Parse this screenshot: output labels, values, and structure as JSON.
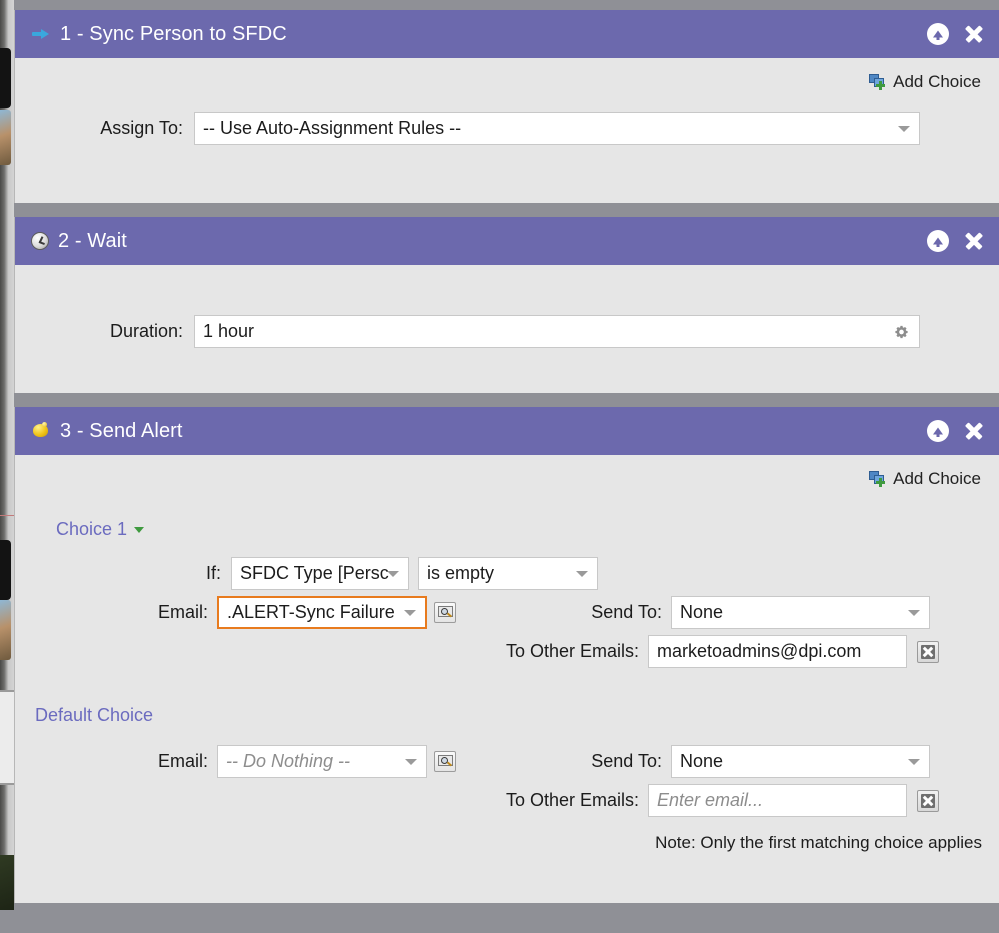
{
  "steps": [
    {
      "icon": "arrow-right-icon",
      "title": "1 - Sync Person to SFDC",
      "collapse_label": "Collapse step",
      "close_label": "Remove step",
      "add_choice_label": "Add Choice",
      "assign_to_label": "Assign To:",
      "assign_to_value": "-- Use Auto-Assignment Rules --"
    },
    {
      "icon": "clock-icon",
      "title": "2 - Wait",
      "duration_label": "Duration:",
      "duration_value": "1 hour"
    },
    {
      "icon": "bell-icon",
      "title": "3 - Send Alert",
      "add_choice_label": "Add Choice",
      "choice_1": {
        "label": "Choice 1",
        "if_label": "If:",
        "if_field_value": "SFDC Type [Persc",
        "if_operator_value": "is empty",
        "email_label": "Email:",
        "email_value": ".ALERT-Sync Failure",
        "send_to_label": "Send To:",
        "send_to_value": "None",
        "to_other_emails_label": "To Other Emails:",
        "to_other_emails_value": "marketoadmins@dpi.com"
      },
      "default_choice": {
        "label": "Default Choice",
        "email_label": "Email:",
        "email_value": "-- Do Nothing --",
        "send_to_label": "Send To:",
        "send_to_value": "None",
        "to_other_emails_label": "To Other Emails:",
        "to_other_emails_placeholder": "Enter email..."
      },
      "note": "Note: Only the first matching choice applies"
    }
  ],
  "colors": {
    "header_purple": "#6c69ad",
    "panel_gray": "#e6e6e6",
    "gap_gray": "#8f9096",
    "link_purple": "#6b6bbf",
    "highlight_orange": "#e87b1e"
  }
}
